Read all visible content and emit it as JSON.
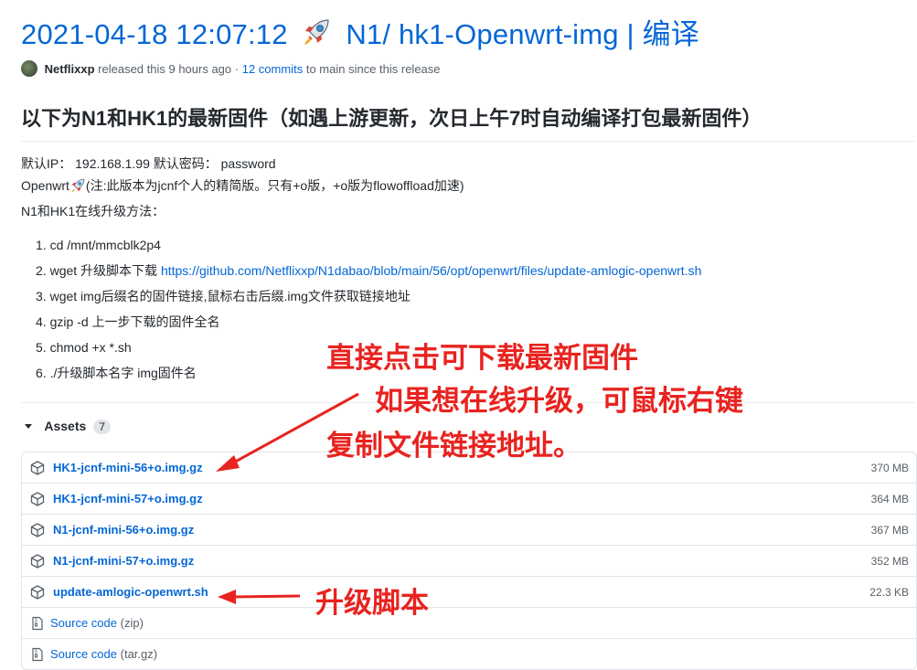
{
  "release": {
    "title_prefix": "2021-04-18 12:07:12",
    "title_suffix": "N1/ hk1-Openwrt-img | 编译",
    "author": "Netflixxp",
    "released_text": "released this 9 hours ago",
    "separator": "·",
    "commits_link": "12 commits",
    "since_text": "to main since this release"
  },
  "body": {
    "heading": "以下为N1和HK1的最新固件（如遇上游更新，次日上午7时自动编译打包最新固件）",
    "line1": "默认IP： 192.168.1.99 默认密码：  password",
    "line2_prefix": "Openwrt",
    "line2_suffix": "(注:此版本为jcnf个人的精简版。只有+o版，+o版为flowoffload加速)",
    "line3": "N1和HK1在线升级方法："
  },
  "steps": [
    {
      "num": "1.",
      "text": "cd /mnt/mmcblk2p4"
    },
    {
      "num": "2.",
      "text": "wget 升级脚本下载 ",
      "link": "https://github.com/Netflixxp/N1dabao/blob/main/56/opt/openwrt/files/update-amlogic-openwrt.sh"
    },
    {
      "num": "3.",
      "text": "wget img后缀名的固件链接,鼠标右击后缀.img文件获取链接地址"
    },
    {
      "num": "4.",
      "text": "gzip -d 上一步下载的固件全名"
    },
    {
      "num": "5.",
      "text": "chmod +x *.sh"
    },
    {
      "num": "6.",
      "text": "./升级脚本名字 img固件名"
    }
  ],
  "assets": {
    "label": "Assets",
    "count": "7",
    "files": [
      {
        "name": "HK1-jcnf-mini-56+o.img.gz",
        "size": "370 MB",
        "icon": "package-icon"
      },
      {
        "name": "HK1-jcnf-mini-57+o.img.gz",
        "size": "364 MB",
        "icon": "package-icon"
      },
      {
        "name": "N1-jcnf-mini-56+o.img.gz",
        "size": "367 MB",
        "icon": "package-icon"
      },
      {
        "name": "N1-jcnf-mini-57+o.img.gz",
        "size": "352 MB",
        "icon": "package-icon"
      },
      {
        "name": "update-amlogic-openwrt.sh",
        "size": "22.3 KB",
        "icon": "package-icon"
      }
    ],
    "sources": [
      {
        "label": "Source code",
        "format": "(zip)",
        "icon": "file-zip-icon"
      },
      {
        "label": "Source code",
        "format": "(tar.gz)",
        "icon": "file-zip-icon"
      }
    ]
  },
  "annotations": {
    "line1": "直接点击可下载最新固件",
    "line2": "如果想在线升级，可鼠标右键",
    "line3": "复制文件链接地址。",
    "script_note": "升级脚本"
  },
  "colors": {
    "link": "#0366d6",
    "annotation": "#e8231f",
    "muted": "#586069"
  }
}
